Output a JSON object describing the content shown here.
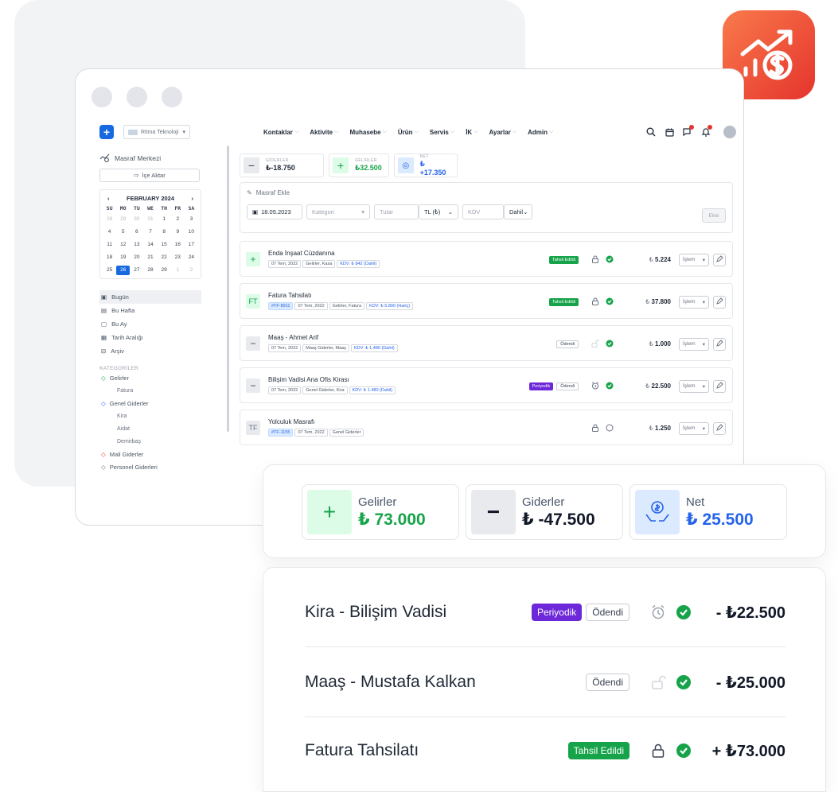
{
  "colors": {
    "accent": "#1769e0",
    "income": "#16a34a",
    "expense": "#111827",
    "net": "#2563eb",
    "badge_gradient": [
      "#f97a4b",
      "#e5342d"
    ]
  },
  "brand_badge": {
    "icon": "growth-chart-coin-icon"
  },
  "app": {
    "company": "Ritma Teknoloji",
    "nav": [
      "Kontaklar",
      "Aktivite",
      "Muhasebe",
      "Ürün",
      "Servis",
      "İK",
      "Ayarlar",
      "Admin"
    ],
    "tools": [
      "search-icon",
      "calendar-icon",
      "chat-icon",
      "bell-icon",
      "avatar"
    ]
  },
  "sidebar": {
    "title": "Masraf Merkezi",
    "import_label": "İçe Aktar",
    "calendar": {
      "month": "FEBRUARY 2024",
      "weekdays": [
        "SU",
        "MO",
        "TU",
        "WE",
        "TH",
        "FR",
        "SA"
      ],
      "days": [
        {
          "d": "28",
          "m": true
        },
        {
          "d": "29",
          "m": true
        },
        {
          "d": "30",
          "m": true
        },
        {
          "d": "31",
          "m": true
        },
        {
          "d": "1"
        },
        {
          "d": "2"
        },
        {
          "d": "3"
        },
        {
          "d": "4"
        },
        {
          "d": "5"
        },
        {
          "d": "6"
        },
        {
          "d": "7"
        },
        {
          "d": "8"
        },
        {
          "d": "9"
        },
        {
          "d": "10"
        },
        {
          "d": "11"
        },
        {
          "d": "12"
        },
        {
          "d": "13"
        },
        {
          "d": "14"
        },
        {
          "d": "15"
        },
        {
          "d": "16"
        },
        {
          "d": "17"
        },
        {
          "d": "18"
        },
        {
          "d": "19"
        },
        {
          "d": "20"
        },
        {
          "d": "21"
        },
        {
          "d": "22"
        },
        {
          "d": "23"
        },
        {
          "d": "24"
        },
        {
          "d": "25"
        },
        {
          "d": "26",
          "sel": true
        },
        {
          "d": "27"
        },
        {
          "d": "28"
        },
        {
          "d": "29"
        },
        {
          "d": "1",
          "m": true
        },
        {
          "d": "2",
          "m": true
        }
      ]
    },
    "periods": [
      "Bugün",
      "Bu Hafta",
      "Bu Ay",
      "Tarih Aralığı",
      "Arşiv"
    ],
    "categories_title": "KATEGORİLER",
    "categories": {
      "gelirler": "Gelirler",
      "fatura": "Fatura",
      "genel": "Genel Giderler",
      "kira": "Kira",
      "aidat": "Aidat",
      "demirbas": "Demirbaş",
      "mali": "Mali Giderler",
      "personel": "Personel Giderleri"
    }
  },
  "stats": {
    "giderler": {
      "label": "GİDERLER",
      "value": "₺-18.750"
    },
    "gelirler": {
      "label": "GELİRLER",
      "value": "₺32.500"
    },
    "net": {
      "label": "NET",
      "value": "₺+17.350"
    }
  },
  "add_form": {
    "title": "Masraf Ekle",
    "date": "18.05.2023",
    "category_placeholder": "Kategori",
    "amount_placeholder": "Tutar",
    "currency": "TL (₺)",
    "kdv_placeholder": "KDV",
    "kdv_mode": "Dahil",
    "add_label": "Ekle"
  },
  "rows": [
    {
      "icon": "+",
      "title": "Enda İnşaat Cüzdanına",
      "chips": [
        "07 Tem, 2022",
        "Gelirler, Kasa"
      ],
      "kdv": "KDV: ₺ 842 (Dahil)",
      "badge": "Tahsil Edildi",
      "amount": "5.224",
      "op": "İşlem"
    },
    {
      "icon": "FT",
      "title": "Fatura Tahsilatı",
      "tag": "#TF-8911",
      "chips": [
        "07 Tem, 2022",
        "Gelirler, Fatura"
      ],
      "kdv": "KDV: ₺ 5.800 (Hariç)",
      "badge": "Tahsil Edildi",
      "amount": "37.800",
      "op": "İşlem"
    },
    {
      "icon": "−",
      "title": "Maaş - Ahmet Arif",
      "chips": [
        "07 Tem, 2022",
        "Maaş Giderler, Maaş"
      ],
      "kdv": "KDV: ₺ 1.480 (Dahil)",
      "badge": "Ödendi",
      "amount": "1.000",
      "op": "İşlem"
    },
    {
      "icon": "−",
      "title": "Bilişim Vadisi Ana Ofis Kirası",
      "chips": [
        "07 Tem, 2022",
        "Genel Giderler, Kira"
      ],
      "kdv": "KDV: ₺ 1.480 (Dahil)",
      "badge": "Periyodik",
      "badge2": "Ödendi",
      "amount": "22.500",
      "op": "İşlem"
    },
    {
      "icon": "TF",
      "title": "Yolculuk Masrafı",
      "tag": "#TF-1155",
      "chips": [
        "07 Tem, 2022",
        "Genel Giderler"
      ],
      "amount": "1.250",
      "op": "İşlem"
    }
  ],
  "currency_symbol": "₺",
  "summary": {
    "gelirler": {
      "label": "Gelirler",
      "value": "₺ 73.000"
    },
    "giderler": {
      "label": "Giderler",
      "value": "₺ -47.500"
    },
    "net": {
      "label": "Net",
      "value": "₺ 25.500"
    }
  },
  "list": [
    {
      "title": "Kira - Bilişim Vadisi",
      "badge1": "Periyodik",
      "badge2": "Ödendi",
      "amount": "- ₺22.500"
    },
    {
      "title": "Maaş - Mustafa Kalkan",
      "badge2": "Ödendi",
      "amount": "- ₺25.000"
    },
    {
      "title": "Fatura Tahsilatı",
      "badge1": "Tahsil Edildi",
      "amount": "+ ₺73.000"
    }
  ]
}
